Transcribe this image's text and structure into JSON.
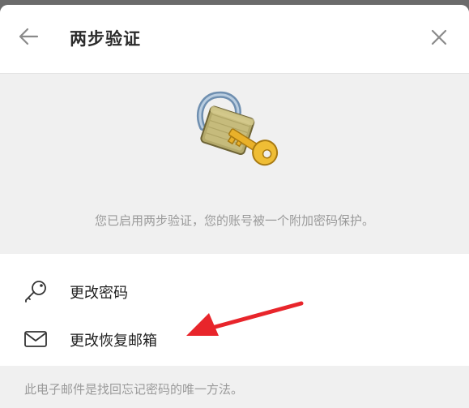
{
  "header": {
    "title": "两步验证",
    "back_icon": "arrow-left-icon",
    "close_icon": "close-icon"
  },
  "hero": {
    "illustration": "padlock-key-icon",
    "description": "您已启用两步验证，您的账号被一个附加密码保护。"
  },
  "menu": {
    "items": [
      {
        "icon": "key-icon",
        "label": "更改密码"
      },
      {
        "icon": "envelope-icon",
        "label": "更改恢复邮箱"
      }
    ]
  },
  "annotation": {
    "icon": "red-arrow-icon",
    "color": "#e8252b"
  },
  "footer": {
    "note": "此电子邮件是找回忘记密码的唯一方法。"
  },
  "colors": {
    "background": "#f0f0f0",
    "text_primary": "#1f1f1f",
    "text_secondary": "#9a9a9a",
    "lock_body": "#b9ad6f",
    "key_gold": "#e9b12a"
  }
}
